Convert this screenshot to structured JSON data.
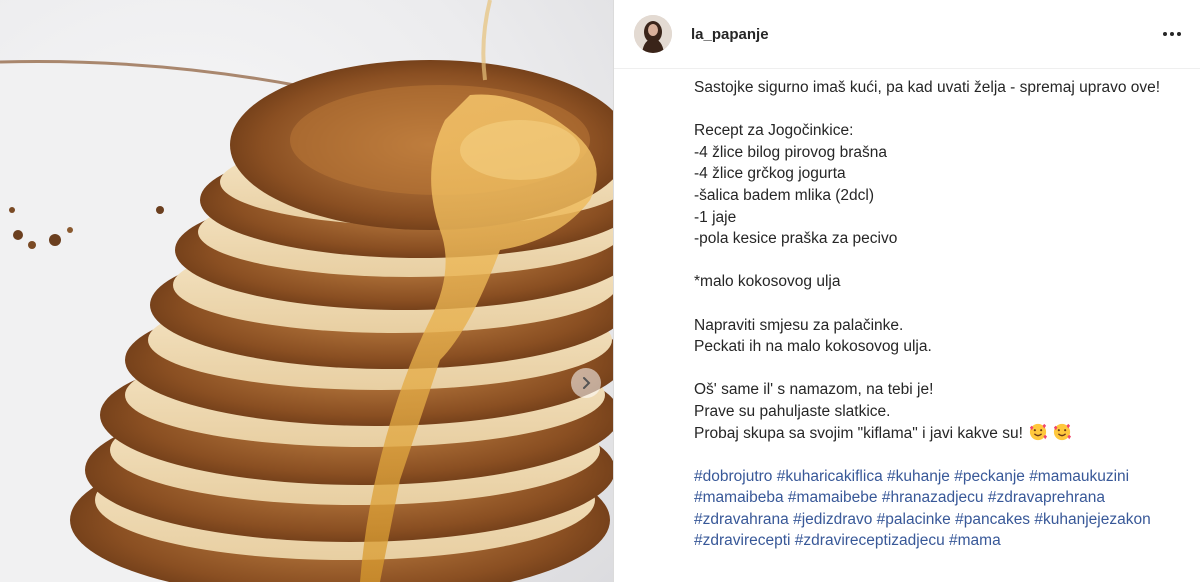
{
  "post": {
    "author": {
      "username": "la_papanje",
      "avatar": "profile-photo"
    },
    "more_icon": "more-horizontal-icon",
    "image": {
      "alt_subject": "pancake-stack-with-honey",
      "next_icon": "chevron-right-icon"
    },
    "caption": {
      "intro": "Sastojke sigurno imaš kući, pa kad uvati želja - spremaj upravo ove!",
      "recipe_title": "Recept za Jogočinkice:",
      "ingredients": [
        "-4 žlice bilog pirovog brašna",
        "-4 žlice grčkog jogurta",
        "-šalica badem mlika (2dcl)",
        "-1 jaje",
        "-pola kesice praška za pecivo"
      ],
      "note": "*malo kokosovog ulja",
      "steps": [
        "Napraviti smjesu za palačinke.",
        "Peckati ih na malo kokosovog ulja."
      ],
      "outro": [
        "Oš' same il' s namazom, na tebi je!",
        "Prave su pahuljaste slatkice.",
        "Probaj skupa sa svojim \"kiflama\" i javi kakve su!"
      ],
      "emojis": [
        "smiling-face-with-hearts-emoji",
        "smiling-face-with-hearts-emoji"
      ],
      "hashtags": "#dobrojutro #kuharicakiflica #kuhanje #peckanje #mamaukuzini #mamaibeba #mamaibebe #hranazadjecu #zdravaprehrana #zdravahrana #jedizdravo #palacinke #pancakes #kuhanjejezakon #zdravirecepti #zdravireceptizadjecu #mama"
    },
    "colors": {
      "hashtag": "#385898",
      "text": "#262626",
      "border": "#dbdbdb"
    }
  }
}
